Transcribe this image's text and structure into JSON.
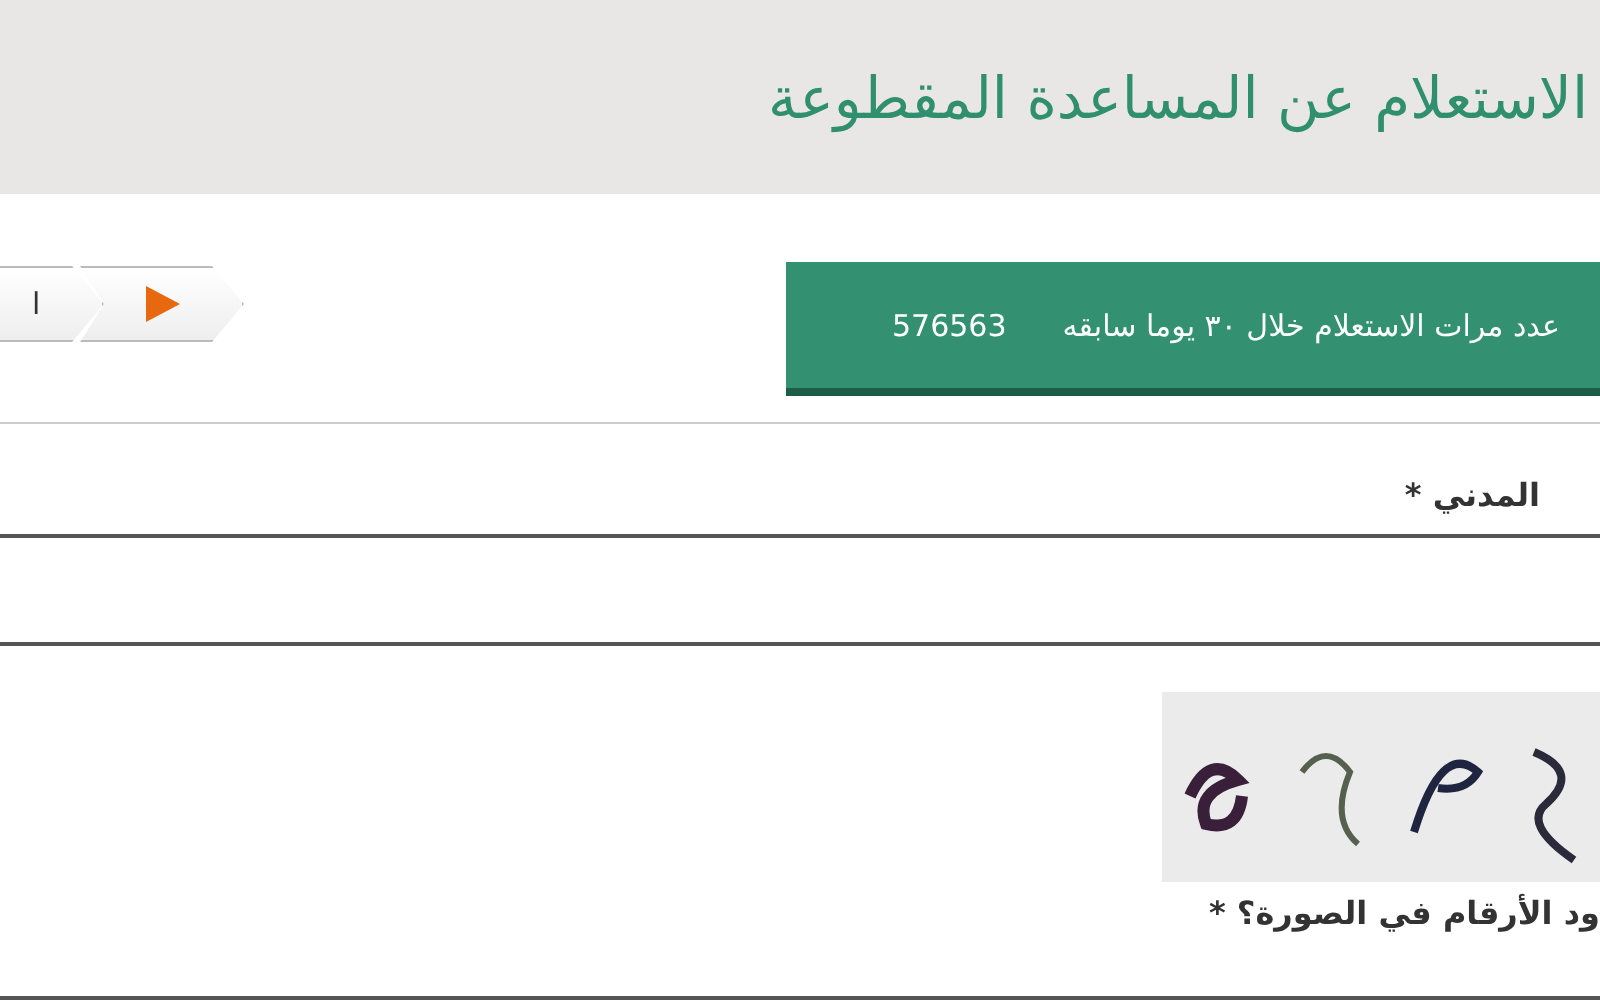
{
  "header": {
    "title": "الاستعلام عن المساعدة المقطوعة"
  },
  "stats_bar": {
    "label": "عدد مرات الاستعلام خلال ٣٠ يوما سابقه",
    "count": "576563"
  },
  "breadcrumb": [
    {
      "kind": "play"
    },
    {
      "kind": "text",
      "label": "ا"
    }
  ],
  "civil_id": {
    "label": "المدني *"
  },
  "captcha": {
    "label": "ود الأرقام في الصورة؟ *"
  }
}
